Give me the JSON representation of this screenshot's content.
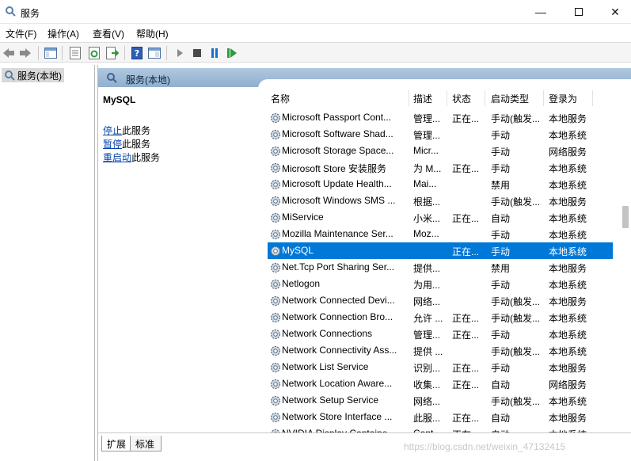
{
  "window": {
    "title": "服务"
  },
  "menu": [
    "文件(F)",
    "操作(A)",
    "查看(V)",
    "帮助(H)"
  ],
  "toolbar_icons": [
    "back-icon",
    "forward-icon",
    "show-hide-console-tree-icon",
    "properties-icon",
    "refresh-icon",
    "export-list-icon",
    "help-icon",
    "view-icon",
    "start-service-icon",
    "stop-service-icon",
    "pause-service-icon",
    "restart-service-icon"
  ],
  "tree": {
    "label": "服务(本地)"
  },
  "pane": {
    "header": "服务(本地)"
  },
  "extended": {
    "service_name": "MySQL",
    "actions": [
      {
        "link": "停止",
        "rest": "此服务"
      },
      {
        "link": "暂停",
        "rest": "此服务"
      },
      {
        "link": "重启动",
        "rest": "此服务"
      }
    ]
  },
  "columns": [
    "名称",
    "描述",
    "状态",
    "启动类型",
    "登录为"
  ],
  "rows": [
    {
      "name": "Microsoft Passport Cont...",
      "desc": "管理...",
      "status": "正在...",
      "startup": "手动(触发...",
      "logon": "本地服务"
    },
    {
      "name": "Microsoft Software Shad...",
      "desc": "管理...",
      "status": "",
      "startup": "手动",
      "logon": "本地系统"
    },
    {
      "name": "Microsoft Storage Space...",
      "desc": "Micr...",
      "status": "",
      "startup": "手动",
      "logon": "网络服务"
    },
    {
      "name": "Microsoft Store 安装服务",
      "desc": "为 M...",
      "status": "正在...",
      "startup": "手动",
      "logon": "本地系统"
    },
    {
      "name": "Microsoft Update Health...",
      "desc": "Mai...",
      "status": "",
      "startup": "禁用",
      "logon": "本地系统"
    },
    {
      "name": "Microsoft Windows SMS ...",
      "desc": "根据...",
      "status": "",
      "startup": "手动(触发...",
      "logon": "本地服务"
    },
    {
      "name": "MiService",
      "desc": "小米...",
      "status": "正在...",
      "startup": "自动",
      "logon": "本地系统"
    },
    {
      "name": "Mozilla Maintenance Ser...",
      "desc": "Moz...",
      "status": "",
      "startup": "手动",
      "logon": "本地系统"
    },
    {
      "name": "MySQL",
      "desc": "",
      "status": "正在...",
      "startup": "手动",
      "logon": "本地系统",
      "selected": true
    },
    {
      "name": "Net.Tcp Port Sharing Ser...",
      "desc": "提供...",
      "status": "",
      "startup": "禁用",
      "logon": "本地服务"
    },
    {
      "name": "Netlogon",
      "desc": "为用...",
      "status": "",
      "startup": "手动",
      "logon": "本地系统"
    },
    {
      "name": "Network Connected Devi...",
      "desc": "网络...",
      "status": "",
      "startup": "手动(触发...",
      "logon": "本地服务"
    },
    {
      "name": "Network Connection Bro...",
      "desc": "允许 ...",
      "status": "正在...",
      "startup": "手动(触发...",
      "logon": "本地系统"
    },
    {
      "name": "Network Connections",
      "desc": "管理...",
      "status": "正在...",
      "startup": "手动",
      "logon": "本地系统"
    },
    {
      "name": "Network Connectivity Ass...",
      "desc": "提供 ...",
      "status": "",
      "startup": "手动(触发...",
      "logon": "本地系统"
    },
    {
      "name": "Network List Service",
      "desc": "识别...",
      "status": "正在...",
      "startup": "手动",
      "logon": "本地服务"
    },
    {
      "name": "Network Location Aware...",
      "desc": "收集...",
      "status": "正在...",
      "startup": "自动",
      "logon": "网络服务"
    },
    {
      "name": "Network Setup Service",
      "desc": "网络...",
      "status": "",
      "startup": "手动(触发...",
      "logon": "本地系统"
    },
    {
      "name": "Network Store Interface ...",
      "desc": "此服...",
      "status": "正在...",
      "startup": "自动",
      "logon": "本地服务"
    },
    {
      "name": "NVIDIA Display Containe...",
      "desc": "Cont...",
      "status": "正在...",
      "startup": "自动",
      "logon": "本地系统"
    }
  ],
  "tabs": [
    "扩展",
    "标准"
  ],
  "watermark": "https://blog.csdn.net/weixin_47132415"
}
